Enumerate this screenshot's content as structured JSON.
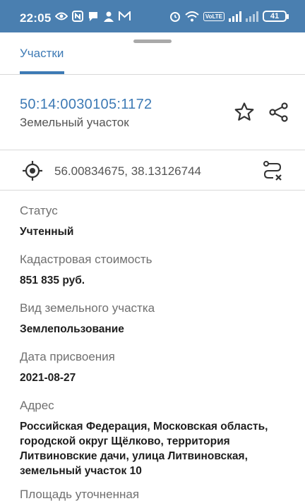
{
  "status_bar": {
    "time": "22:05",
    "volte": "VoLTE",
    "battery": "41",
    "left_icons": [
      "eye-icon",
      "nfc-icon",
      "chat-icon",
      "person-icon",
      "mail-icon"
    ],
    "right_icons": [
      "alarm-icon",
      "wifi-icon",
      "volte-icon",
      "signal-icon",
      "signal-icon-2",
      "battery-icon"
    ]
  },
  "tabs": [
    {
      "label": "Участки",
      "active": true
    }
  ],
  "colors": {
    "accent": "#3d7ab5",
    "status_bar": "#4a7fb0"
  },
  "parcel": {
    "cadastral_number": "50:14:0030105:1172",
    "type": "Земельный участок"
  },
  "coordinates": {
    "text": "56.00834675, 38.13126744"
  },
  "fields": [
    {
      "label": "Статус",
      "value": "Учтенный"
    },
    {
      "label": "Кадастровая стоимость",
      "value": "851 835 руб."
    },
    {
      "label": "Вид земельного участка",
      "value": "Землепользование"
    },
    {
      "label": "Дата присвоения",
      "value": "2021-08-27"
    },
    {
      "label": "Адрес",
      "value_lines": [
        "Российская Федерация, Московская область,",
        "городской округ Щёлково, территория",
        "Литвиновские дачи, улица Литвиновская,",
        "земельный участок 10"
      ]
    },
    {
      "label": "Площадь уточненная"
    }
  ]
}
